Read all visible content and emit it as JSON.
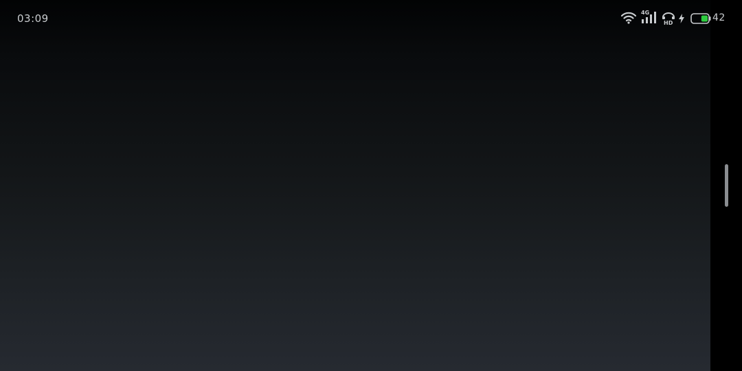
{
  "status_bar": {
    "time": "03:09",
    "network_type": "4G",
    "battery_level": "42",
    "battery_percent": 42,
    "icons": [
      "wifi-icon",
      "signal-icon",
      "hd-voice-icon",
      "charging-icon",
      "battery-icon"
    ],
    "battery_fill_color": "#2ecc40"
  },
  "colors": {
    "background_top": "#020304",
    "background_bottom": "#262a31",
    "scroll_handle": "#8a8d91"
  }
}
